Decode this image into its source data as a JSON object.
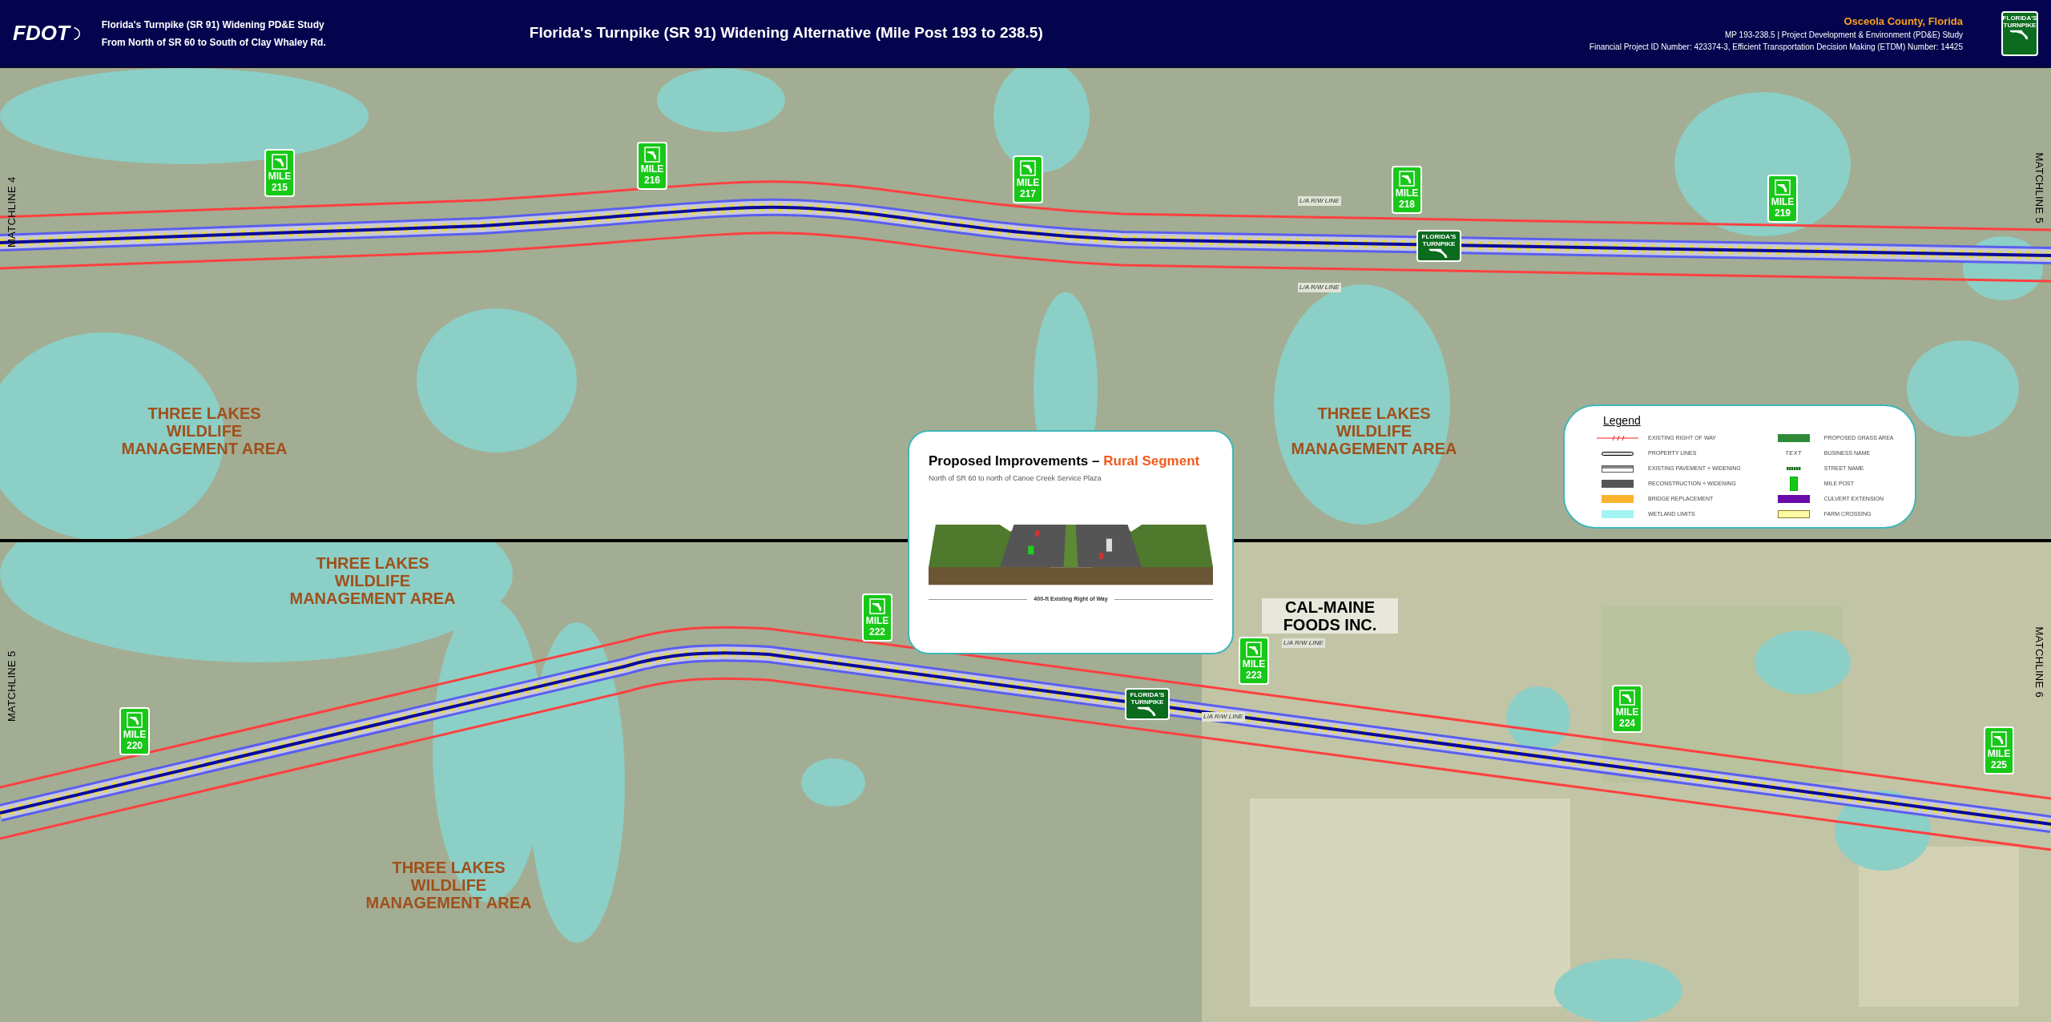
{
  "header": {
    "logo_text": "FDOT",
    "study_title": "Florida's Turnpike (SR 91) Widening PD&E Study",
    "study_subtitle": "From North of SR 60 to South of Clay Whaley Rd.",
    "title": "Florida's Turnpike (SR 91) Widening Alternative (Mile Post 193 to 238.5)",
    "county": "Osceola County, Florida",
    "project_line": "MP 193-238.5 | Project Development & Environment (PD&E) Study",
    "id_line": "Financial Project ID Number: 423374-3, Efficient Transportation Decision Making (ETDM) Number: 14425",
    "shield_text": "FLORIDA'S TURNPIKE"
  },
  "maps": [
    {
      "matchlines": [
        "MATCHLINE 4",
        "MATCHLINE 5"
      ],
      "mile_posts": [
        {
          "label": "MILE",
          "number": "215"
        },
        {
          "label": "MILE",
          "number": "216"
        },
        {
          "label": "MILE",
          "number": "217"
        },
        {
          "label": "MILE",
          "number": "218"
        },
        {
          "label": "MILE",
          "number": "219"
        }
      ],
      "shields": [
        "FLORIDA'S TURNPIKE"
      ],
      "area_labels": [
        "THREE LAKES WILDLIFE MANAGEMENT AREA",
        "THREE LAKES WILDLIFE MANAGEMENT AREA"
      ],
      "rw_labels": [
        "L/A R/W LINE",
        "L/A R/W LINE"
      ]
    },
    {
      "matchlines": [
        "MATCHLINE 5",
        "MATCHLINE 6"
      ],
      "mile_posts": [
        {
          "label": "MILE",
          "number": "220"
        },
        {
          "label": "MILE",
          "number": "222"
        },
        {
          "label": "MILE",
          "number": "223"
        },
        {
          "label": "MILE",
          "number": "224"
        },
        {
          "label": "MILE",
          "number": "225"
        }
      ],
      "shields": [
        "FLORIDA'S TURNPIKE"
      ],
      "area_labels": [
        "THREE LAKES WILDLIFE MANAGEMENT AREA",
        "THREE LAKES WILDLIFE MANAGEMENT AREA"
      ],
      "business_labels": [
        "CAL-MAINE FOODS INC."
      ],
      "rw_labels": [
        "L/A R/W LINE",
        "L/A R/W LINE"
      ]
    }
  ],
  "inset": {
    "title": "Proposed Improvements – ",
    "title_highlight": "Rural Segment",
    "subtitle": "North of SR 60 to north of Canoe Creek Service Plaza",
    "caption": "400-ft Existing Right of Way"
  },
  "legend": {
    "title": "Legend",
    "items": [
      {
        "kind": "rw",
        "label": "EXISTING RIGHT OF WAY"
      },
      {
        "kind": "property",
        "label": "PROPERTY LINES"
      },
      {
        "kind": "pavement",
        "label": "EXISTING PAVEMENT + WIDENING"
      },
      {
        "kind": "solid",
        "color": "#555555",
        "label": "RECONSTRUCTION + WIDENING"
      },
      {
        "kind": "solid",
        "color": "#fbb32e",
        "label": "BRIDGE REPLACEMENT"
      },
      {
        "kind": "solid",
        "color": "#a3f3f3",
        "label": "WETLAND LIMITS"
      },
      {
        "kind": "solid",
        "color": "#2f8a3a",
        "label": "PROPOSED GRASS AREA"
      },
      {
        "kind": "text",
        "sample": "TEXT",
        "label": "BUSINESS NAME"
      },
      {
        "kind": "street",
        "label": "STREET NAME"
      },
      {
        "kind": "milepost",
        "label": "MILE POST"
      },
      {
        "kind": "solid",
        "color": "#6a0aa8",
        "label": "CULVERT EXTENSION"
      },
      {
        "kind": "outlined",
        "color": "#fdfaa6",
        "label": "FARM CROSSING"
      }
    ]
  }
}
